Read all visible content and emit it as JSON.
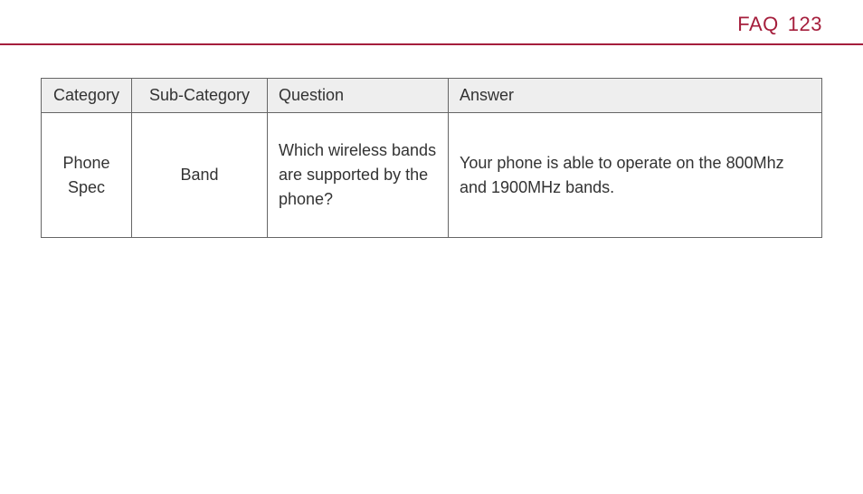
{
  "header": {
    "title": "FAQ",
    "page": "123"
  },
  "table": {
    "headers": {
      "category": "Category",
      "sub_category": "Sub-Category",
      "question": "Question",
      "answer": "Answer"
    },
    "rows": [
      {
        "category": "Phone Spec",
        "sub_category": "Band",
        "question": "Which wireless bands are supported by the phone?",
        "answer": "Your phone is able to operate on the 800Mhz and 1900MHz bands."
      }
    ]
  }
}
